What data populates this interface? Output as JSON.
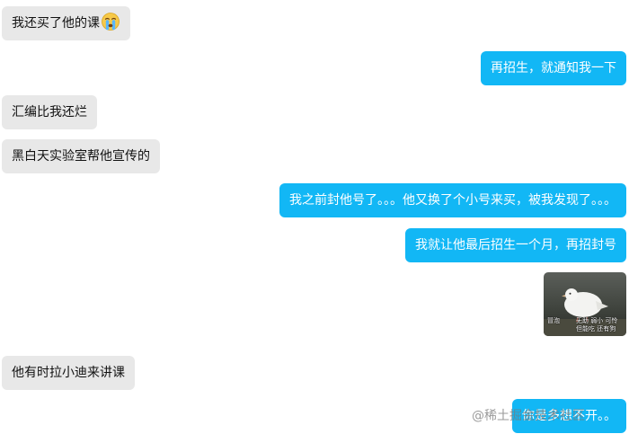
{
  "messages": [
    {
      "side": "left",
      "text": "我还买了他的课"
    },
    {
      "side": "right",
      "text": "再招生，就通知我一下"
    },
    {
      "side": "left",
      "text": "汇编比我还烂"
    },
    {
      "side": "left",
      "text": "黑白天实验室帮他宣传的"
    },
    {
      "side": "right",
      "text": "我之前封他号了。。。他又换了个小号来买，被我发现了。。。"
    },
    {
      "side": "right",
      "text": "我就让他最后招生一个月，再招封号"
    },
    {
      "side": "right",
      "type": "sticker",
      "caption_left": "冒泡",
      "caption_right_1": "无助 弱小 可怜",
      "caption_right_2": "但能吃 还有狗"
    },
    {
      "side": "left",
      "text": "他有时拉小迪来讲课"
    },
    {
      "side": "right",
      "text": "你是多想不开。。"
    }
  ],
  "emoji_icon": "crying-face-icon",
  "watermark": "@稀土掘金技术社区",
  "colors": {
    "incoming_bubble": "#e8e8e8",
    "outgoing_bubble": "#12b7f5",
    "outgoing_text": "#ffffff",
    "incoming_text": "#111111"
  }
}
